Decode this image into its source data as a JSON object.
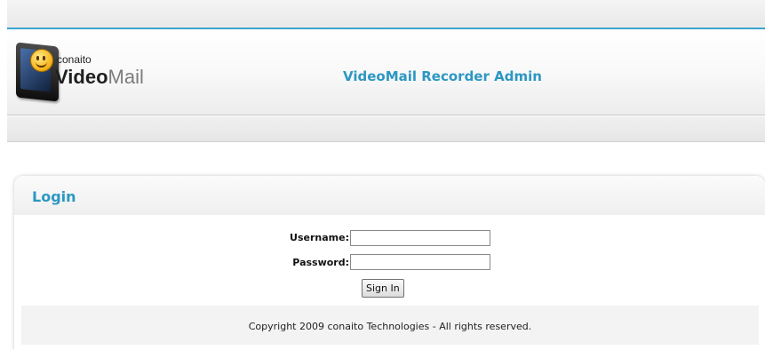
{
  "header": {
    "logo_small": "conaito",
    "logo_video": "Video",
    "logo_mail": "Mail",
    "app_title": "VideoMail Recorder Admin"
  },
  "login": {
    "title": "Login",
    "username_label": "Username:",
    "username_value": "",
    "password_label": "Password:",
    "password_value": "",
    "sign_in": "Sign In"
  },
  "footer": {
    "copyright": "Copyright 2009 conaito Technologies - All rights reserved."
  },
  "colors": {
    "accent": "#2c97c3",
    "top_rule": "#3aa4cf"
  }
}
